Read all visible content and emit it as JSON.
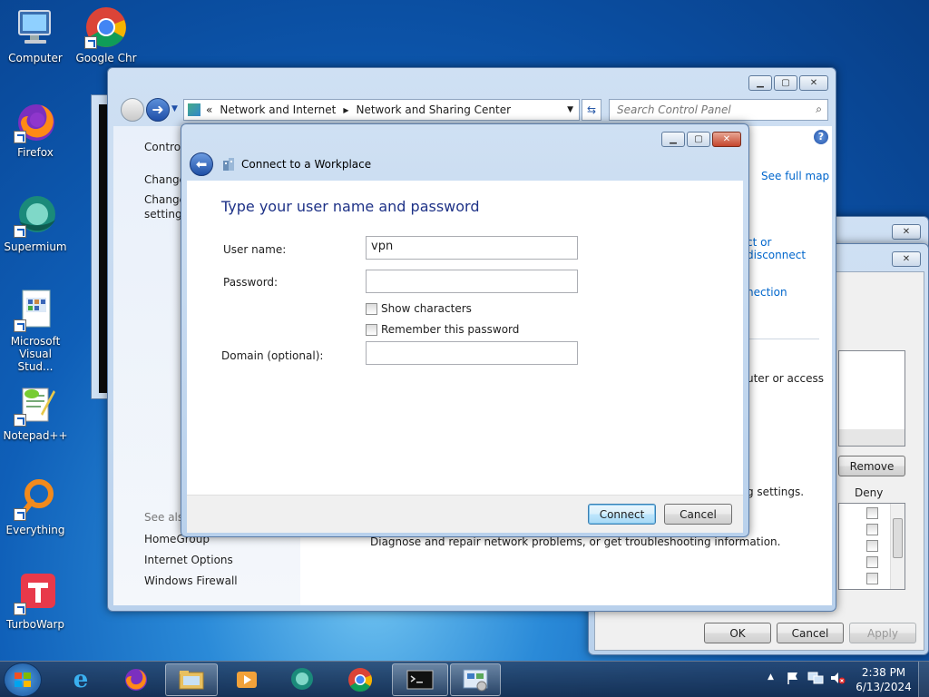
{
  "desktop": {
    "icons": [
      {
        "label": "Computer"
      },
      {
        "label": "Google Chrome",
        "label_visible": "Google Chr"
      },
      {
        "label": "Firefox"
      },
      {
        "label": "Supermium"
      },
      {
        "label_line1": "Microsoft",
        "label_line2": "Visual Stud..."
      },
      {
        "label": "Notepad++"
      },
      {
        "label": "Everything"
      },
      {
        "label": "TurboWarp"
      }
    ]
  },
  "control_panel": {
    "address": {
      "prefix": "«",
      "crumb1": "Network and Internet",
      "crumb2": "Network and Sharing Center"
    },
    "search_placeholder": "Search Control Panel",
    "left_nav": {
      "home_partial": "Control",
      "change1_partial": "Change",
      "change2_line1": "Change",
      "change2_line2": "settings",
      "see_also": "See also",
      "links": [
        "HomeGroup",
        "Internet Options",
        "Windows Firewall"
      ]
    },
    "right": {
      "see_full_map": "See full map",
      "connect_disconnect": "ct or disconnect",
      "connection": "nection",
      "access": "uter or access",
      "settings": "g settings.",
      "diagnose": "Diagnose and repair network problems, or get troubleshooting information."
    }
  },
  "properties_dialog": {
    "remove_label": "Remove",
    "deny_label": "Deny",
    "ok_label": "OK",
    "cancel_label": "Cancel",
    "apply_label": "Apply"
  },
  "vpn_dialog": {
    "title": "Connect to a Workplace",
    "heading": "Type your user name and password",
    "username_label": "User name:",
    "username_value": "vpn",
    "password_label": "Password:",
    "password_value": "",
    "show_characters_label": "Show characters",
    "remember_password_label": "Remember this password",
    "domain_label": "Domain (optional):",
    "domain_value": "",
    "connect_label": "Connect",
    "cancel_label": "Cancel"
  },
  "taskbar": {
    "clock_time": "2:38 PM",
    "clock_date": "6/13/2024"
  },
  "colors": {
    "heading_blue": "#1e3287",
    "link_blue": "#0066cc"
  }
}
